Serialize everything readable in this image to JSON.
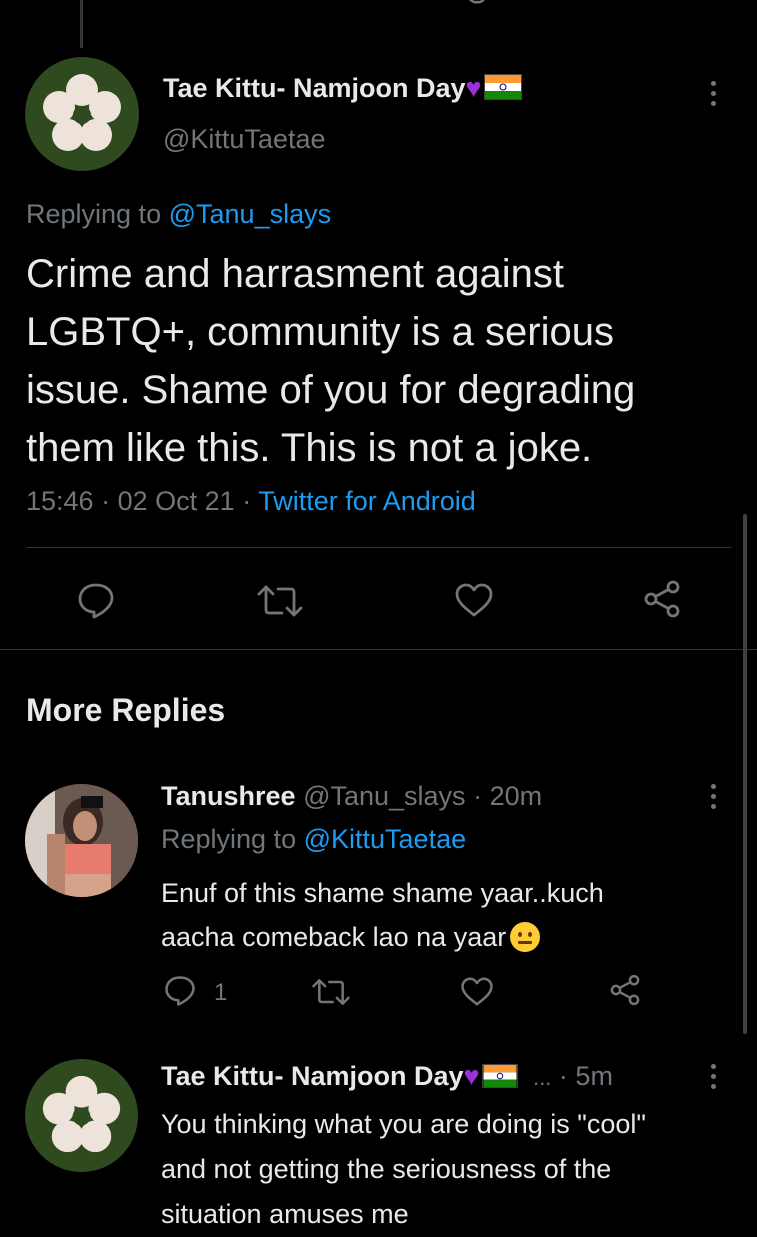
{
  "main_tweet": {
    "display_name": "Tae Kittu- Namjoon Day",
    "handle": "@KittuTaetae",
    "replying_label": "Replying to",
    "replying_handle": "@Tanu_slays",
    "text_lines": [
      "Crime and harrasment against",
      "LGBTQ+, community is a serious",
      "issue. Shame of you for degrading",
      "them like this. This is not a joke."
    ],
    "time": "15:46",
    "date": "02 Oct 21",
    "source": "Twitter for Android"
  },
  "section_title": "More Replies",
  "reply1": {
    "display_name": "Tanushree",
    "handle": "@Tanu_slays",
    "age": "20m",
    "replying_label": "Replying to",
    "replying_handle": "@KittuTaetae",
    "text_line1": "Enuf of this shame shame yaar..kuch",
    "text_line2": "aacha comeback lao na yaar",
    "reply_count": "1"
  },
  "reply2": {
    "display_name": "Tae Kittu- Namjoon Day",
    "ellipsis": "...",
    "age": "5m",
    "text_line1": "You thinking what you are doing is \"cool\"",
    "text_line2": "and not getting the seriousness of the",
    "text_line3": "situation amuses me"
  },
  "colors": {
    "background": "#000000",
    "text": "#e7e9ea",
    "muted": "#71767b",
    "link": "#1d9bf0",
    "purple_heart": "#9b30d9"
  },
  "icons": [
    "reply-icon",
    "retweet-icon",
    "like-icon",
    "share-icon",
    "more-icon",
    "purple-heart-icon",
    "india-flag-icon",
    "neutral-face-icon"
  ]
}
